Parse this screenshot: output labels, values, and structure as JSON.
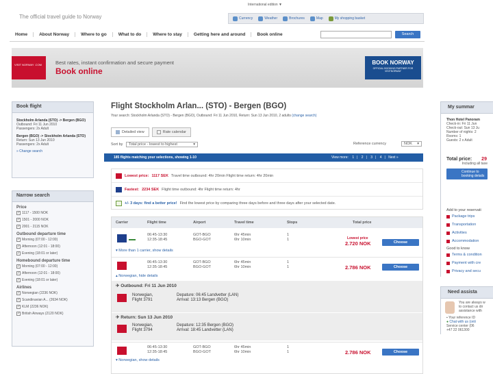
{
  "header": {
    "site_title": "The official travel guide to Norway",
    "international_edition": "International edition ▼",
    "top_links": [
      "Currency",
      "Weather",
      "Brochures",
      "Map",
      "My shopping basket"
    ]
  },
  "nav": {
    "items": [
      "Home",
      "About Norway",
      "Where to go",
      "What to do",
      "Where to stay",
      "Getting here and around",
      "Book online"
    ],
    "search_button": "Search"
  },
  "banner": {
    "logo_text": "VISIT NORWAY .COM",
    "subtitle": "Best rates, instant confirmation and secure payment",
    "title": "Book online",
    "book_norway": "BOOK NORWAY",
    "book_norway_sub": "OFFICIAL BOOKING PARTNER FOR VISITNORWAY"
  },
  "left": {
    "book_flight": {
      "heading": "Book flight",
      "outbound_route": "Stockholm Arlanda (STO) -> Bergen (BGO)",
      "outbound_date": "Outbound: Fri 11 Jun 2010",
      "outbound_pax": "Passengers: 2x Adult",
      "return_route": "Bergen (BGO) -> Stockholm Arlanda (STO)",
      "return_date": "Return: Sun 13 Jun 2010",
      "return_pax": "Passengers: 2x Adult",
      "change_link": "» Change search"
    },
    "narrow": {
      "heading": "Narrow search",
      "price_label": "Price",
      "prices": [
        "1117 - 1500 NOK",
        "1501 - 2000 NOK",
        "2001 - 2115 NOK"
      ],
      "outbound_label": "Outbound departure time",
      "outbound_times": [
        "Morning (07:00 - 12:00)",
        "Afternoon (12:01 - 18:00)",
        "Evening (18:01 or later)"
      ],
      "homebound_label": "Homebound departure time",
      "homebound_times": [
        "Morning (07:00 - 12:00)",
        "Afternoon (12:01 - 18:00)",
        "Evening (18:01 or later)"
      ],
      "airlines_label": "Airlines",
      "airlines": [
        "Norwegian (2236 NOK)",
        "Scandinavian A... (2634 NOK)",
        "KLM (2236 NOK)",
        "British Airways (2120 NOK)"
      ]
    }
  },
  "main": {
    "title": "Flight Stockholm Arlan... (STO) - Bergen (BGO)",
    "your_search": "Your search: Stockholm Arlanda (STO) - Bergen (BGO), Outbound: Fri 11 Jun 2010, Return: Sun 13 Jun 2010, 2 adults",
    "change_search": "(change search)",
    "tab_detailed": "Detailed view",
    "tab_calendar": "Rate calendar",
    "sort_label": "Sort by",
    "sort_value": "Total price - lowest to highest",
    "currency_label": "Reference currency",
    "currency_value": "NOK",
    "matching": "185 flights matching your selections, showing 1-10",
    "view_more": "View more:",
    "pages": [
      "1",
      "2",
      "3",
      "4"
    ],
    "next": "Next »",
    "lowest_label": "Lowest price:",
    "lowest_value": "1117 SEK",
    "lowest_details": "Travel time outbound: 4hr 20min   Flight time return: 4hr 20min",
    "fastest_label": "Fastest:",
    "fastest_value": "2234 SEK",
    "fastest_details": "Flight time outbound: 4hr   Flight time return: 4hr",
    "flex_label": "+/- 3 days: find a better price!",
    "flex_details": "Find the lowest price by comparing three days before and three days after your selected date."
  },
  "table": {
    "headers": [
      "Carrier",
      "Flight time",
      "Airport",
      "Travel time",
      "Stops",
      "Total price"
    ],
    "rows": [
      {
        "times": [
          "06:45-13:30",
          "12:35-18:45"
        ],
        "airports": [
          "GOT-BGO",
          "BGO-GOT"
        ],
        "travel": [
          "6hr 45min",
          "6hr 10min"
        ],
        "stops": [
          "1",
          "1"
        ],
        "price_label": "Lowest price",
        "price": "2.720 NOK",
        "link": "▾ More than 1 carrier, show details",
        "choose": "Choose"
      },
      {
        "times": [
          "06:45-13:30",
          "12:35-18:45"
        ],
        "airports": [
          "GOT-BGO",
          "BGO-GOT"
        ],
        "travel": [
          "6hr 45min",
          "6hr 10min"
        ],
        "stops": [
          "1",
          "1"
        ],
        "price": "2.786 NOK",
        "link": "▴ Norwegian, hide details",
        "choose": "Choose"
      },
      {
        "times": [
          "06:45-13:30",
          "12:35-18:45"
        ],
        "airports": [
          "GOT-BGO",
          "BGO-GOT"
        ],
        "travel": [
          "6hr 45min",
          "6hr 10min"
        ],
        "stops": [
          "1",
          "1"
        ],
        "price": "2.786 NOK",
        "link": "▾ Norwegian, show details",
        "choose": "Choose"
      }
    ],
    "outbound_title": "Outbound: Fri 11 Jun 2010",
    "outbound_flight": [
      "Norwegian,",
      "Flight 3791"
    ],
    "outbound_times": [
      "Depature: 06:45 Landvetter (LAN)",
      "Arrival: 13:13 Bergen (BGO)"
    ],
    "return_title": "Return: Sun 13 Jun 2010",
    "return_flight": [
      "Norwegian,",
      "Flight 3794"
    ],
    "return_times": [
      "Depature: 12:35 Bergen (BGO)",
      "Arrival: 18:45 Landvetter (LAN)"
    ]
  },
  "right": {
    "summary_heading": "My summar",
    "hotel": "Thon Hotel Panoram",
    "checkin": "Check-in: Fri 11 Jun",
    "checkout": "Check-out: Sun 13 Ju",
    "nights": "Number of nights: 2",
    "rooms": "Rooms: 1",
    "guests": "Guests: 2 x Adult",
    "total_label": "Total price:",
    "total_value": "29",
    "including": "Including all taxe",
    "continue_btn": "Continue to booking details",
    "add_label": "Add to your reservati",
    "add_items": [
      "Package trips",
      "Transportation",
      "Activities",
      "Accommodation"
    ],
    "good_label": "Good to know",
    "good_items": [
      "Terms & condition",
      "Payment with cre",
      "Privacy and secu"
    ],
    "need_heading": "Need assista",
    "help_lines": [
      "You are always w",
      "to contact us dir",
      "assistance with"
    ],
    "reference": "Your reference ID",
    "chat": "Chat with us (onli",
    "service_center": "Service center (06",
    "phone": "+47 22 061300"
  }
}
